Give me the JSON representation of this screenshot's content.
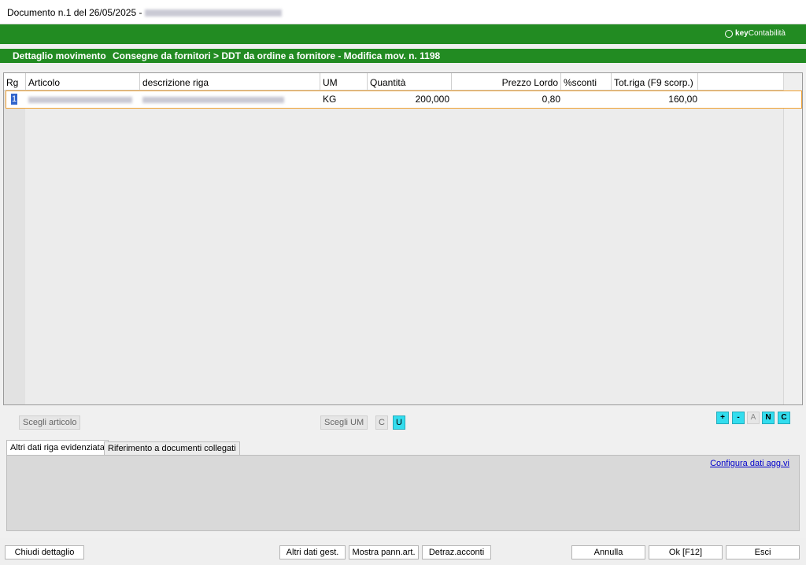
{
  "window": {
    "title": "Documento n.1 del 26/05/2025 - "
  },
  "brand": {
    "prefix": "key",
    "suffix": "Contabilità"
  },
  "header": {
    "section": "Dettaglio movimento",
    "path": "Consegne da fornitori > DDT da ordine a fornitore - Modifica mov. n. 1198"
  },
  "grid": {
    "columns": [
      "Rg",
      "Articolo",
      "descrizione riga",
      "UM",
      "Quantità",
      "Prezzo Lordo",
      "%sconti",
      "Tot.riga (F9 scorp.)"
    ],
    "rows": [
      {
        "rg": "1",
        "articolo": "",
        "descrizione": "",
        "um": "KG",
        "quantita": "200,000",
        "prezzo_lordo": "0,80",
        "sconti": "",
        "tot_riga": "160,00"
      }
    ]
  },
  "tools": {
    "scegli_articolo": "Scegli articolo",
    "scegli_um": "Scegli UM",
    "um_c": "C",
    "um_u": "U",
    "plus": "+",
    "minus": "-",
    "a": "A",
    "n": "N",
    "c": "C"
  },
  "tabs": [
    "Altri dati riga evidenziata",
    "Riferimento a documenti collegati"
  ],
  "panel": {
    "link": "Configura dati agg.vi"
  },
  "footer": {
    "chiudi": "Chiudi dettaglio",
    "altri_dati": "Altri dati gest.",
    "mostra_pann": "Mostra pann.art.",
    "detraz": "Detraz.acconti",
    "annulla": "Annulla",
    "ok": "Ok [F12]",
    "esci": "Esci"
  },
  "colors": {
    "brand_green": "#228b22",
    "highlight_row": "#f0a030",
    "cyan_button": "#33ddee"
  }
}
